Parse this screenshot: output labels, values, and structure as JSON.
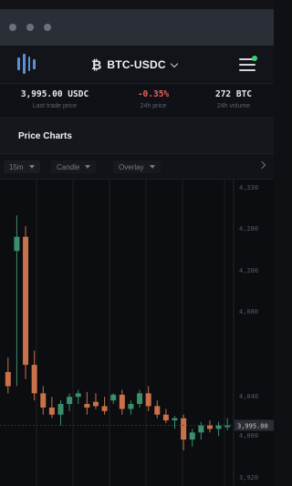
{
  "window": {
    "dots": [
      "dot-1",
      "dot-2",
      "dot-3"
    ]
  },
  "header": {
    "logo_icon": "exchange-logo-icon",
    "currency_icon": "bitcoin-icon",
    "currency_glyph": "₿",
    "market": "BTC-USDC",
    "menu_icon": "hamburger-menu-icon",
    "notification_color": "#3bd16f"
  },
  "stats": [
    {
      "value": "3,995.00 USDC",
      "label": "Last trade price"
    },
    {
      "value": "-0.35%",
      "label": "24h price",
      "color": "#e8635a"
    },
    {
      "value": "272 BTC",
      "label": "24h volume"
    }
  ],
  "section": {
    "title": "Price Charts"
  },
  "toolbar": {
    "interval": "15m",
    "chart_type": "Candle",
    "overlay": "Overlay"
  },
  "chart_data": {
    "type": "candlestick",
    "y_ticks": [
      "4,330",
      "4,280",
      "4,200",
      "4,080",
      "4,040",
      "3,995.00",
      "4,000",
      "3,920"
    ],
    "last_price": "3,995.00",
    "colors": {
      "up": "#3a8f6c",
      "down": "#c8714a",
      "grid": "#1d1f25"
    },
    "candles": [
      {
        "o": 4070,
        "h": 4090,
        "l": 4040,
        "c": 4050,
        "dir": "down"
      },
      {
        "o": 4240,
        "h": 4290,
        "l": 4050,
        "c": 4260,
        "dir": "up"
      },
      {
        "o": 4260,
        "h": 4275,
        "l": 4060,
        "c": 4080,
        "dir": "down"
      },
      {
        "o": 4080,
        "h": 4100,
        "l": 4030,
        "c": 4040,
        "dir": "down"
      },
      {
        "o": 4040,
        "h": 4050,
        "l": 4010,
        "c": 4020,
        "dir": "down"
      },
      {
        "o": 4020,
        "h": 4035,
        "l": 4005,
        "c": 4010,
        "dir": "down"
      },
      {
        "o": 4010,
        "h": 4030,
        "l": 3995,
        "c": 4025,
        "dir": "up"
      },
      {
        "o": 4025,
        "h": 4040,
        "l": 4015,
        "c": 4035,
        "dir": "up"
      },
      {
        "o": 4035,
        "h": 4045,
        "l": 4025,
        "c": 4040,
        "dir": "up"
      },
      {
        "o": 4020,
        "h": 4042,
        "l": 4010,
        "c": 4025,
        "dir": "down"
      },
      {
        "o": 4028,
        "h": 4040,
        "l": 4018,
        "c": 4022,
        "dir": "down"
      },
      {
        "o": 4022,
        "h": 4035,
        "l": 4010,
        "c": 4015,
        "dir": "down"
      },
      {
        "o": 4030,
        "h": 4040,
        "l": 4025,
        "c": 4038,
        "dir": "up"
      },
      {
        "o": 4038,
        "h": 4045,
        "l": 4010,
        "c": 4018,
        "dir": "down"
      },
      {
        "o": 4018,
        "h": 4030,
        "l": 4010,
        "c": 4025,
        "dir": "up"
      },
      {
        "o": 4025,
        "h": 4045,
        "l": 4020,
        "c": 4040,
        "dir": "up"
      },
      {
        "o": 4040,
        "h": 4050,
        "l": 4015,
        "c": 4022,
        "dir": "down"
      },
      {
        "o": 4022,
        "h": 4030,
        "l": 4005,
        "c": 4010,
        "dir": "down"
      },
      {
        "o": 4010,
        "h": 4018,
        "l": 3998,
        "c": 4002,
        "dir": "down"
      },
      {
        "o": 4002,
        "h": 4008,
        "l": 3990,
        "c": 4005,
        "dir": "up"
      },
      {
        "o": 4005,
        "h": 4010,
        "l": 3960,
        "c": 3975,
        "dir": "down"
      },
      {
        "o": 3975,
        "h": 3990,
        "l": 3965,
        "c": 3985,
        "dir": "up"
      },
      {
        "o": 3985,
        "h": 4000,
        "l": 3975,
        "c": 3995,
        "dir": "up"
      },
      {
        "o": 3995,
        "h": 4002,
        "l": 3985,
        "c": 3990,
        "dir": "down"
      },
      {
        "o": 3990,
        "h": 4000,
        "l": 3980,
        "c": 3995,
        "dir": "up"
      },
      {
        "o": 3995,
        "h": 4005,
        "l": 3988,
        "c": 3995,
        "dir": "up"
      }
    ]
  }
}
